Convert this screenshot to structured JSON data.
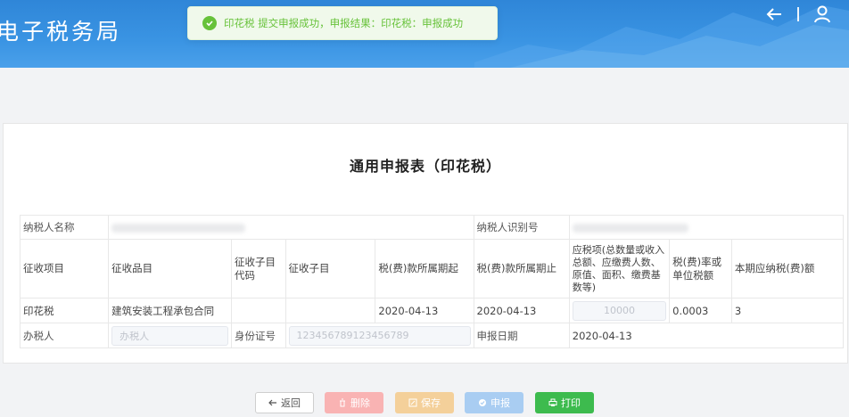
{
  "header": {
    "brand": "电子税务局",
    "icons": [
      "back-arrow-icon",
      "user-icon"
    ]
  },
  "toast": {
    "message": "印花税 提交申报成功，申报结果：印花税：申报成功",
    "icon": "check-circle-icon",
    "color": "#67c23a"
  },
  "form": {
    "title": "通用申报表（印花税）",
    "taxpayer_name_label": "纳税人名称",
    "taxpayer_id_label": "纳税人识别号",
    "columns": [
      "征收项目",
      "征收品目",
      "征收子目代码",
      "征收子目",
      "税(费)款所属期起",
      "税(费)款所属期止",
      "应税项(总数量或收入总额、应缴费人数、原值、面积、缴费基数等)",
      "税(费)率或单位税额",
      "本期应纳税(费)额"
    ],
    "row": {
      "item": "印花税",
      "category": "建筑安装工程承包合同",
      "sub_code": "",
      "sub_item": "",
      "period_start": "2020-04-13",
      "period_end": "2020-04-13",
      "taxable_amount": "10000",
      "rate": "0.0003",
      "tax_due": "3"
    },
    "handler_label": "办税人",
    "handler_placeholder": "办税人",
    "id_label": "身份证号",
    "id_value": "123456789123456789",
    "declare_date_label": "申报日期",
    "declare_date": "2020-04-13"
  },
  "buttons": {
    "back": "返回",
    "delete": "删除",
    "save": "保存",
    "submit": "申报",
    "print": "打印"
  },
  "colors": {
    "header": "#3a94e3",
    "success": "#67c23a",
    "print_button": "#3dbb4e",
    "delete_button": "#f9b3b3",
    "save_button": "#f4d09a",
    "submit_button": "#a9cdf2"
  }
}
